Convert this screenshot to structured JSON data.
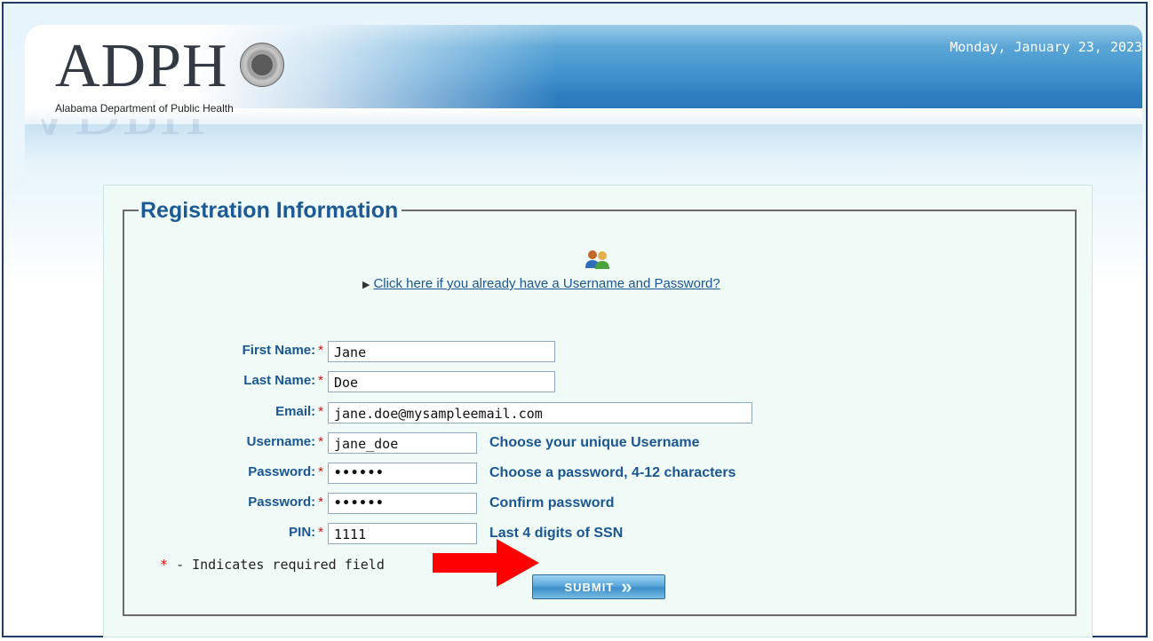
{
  "header": {
    "logo_text": "ADPH",
    "org_name": "Alabama Department of Public Health",
    "date": "Monday, January 23, 2023"
  },
  "form": {
    "legend": "Registration Information",
    "existing_account_link": "Click here if you already have a Username and Password?",
    "required_marker": "*",
    "fields": {
      "first_name": {
        "label": "First Name:",
        "value": "Jane"
      },
      "last_name": {
        "label": "Last Name:",
        "value": "Doe"
      },
      "email": {
        "label": "Email:",
        "value": "jane.doe@mysampleemail.com"
      },
      "username": {
        "label": "Username:",
        "value": "jane_doe",
        "hint": "Choose your unique Username"
      },
      "password": {
        "label": "Password:",
        "value": "••••••",
        "hint": "Choose a password, 4-12 characters"
      },
      "password_confirm": {
        "label": "Password:",
        "value": "••••••",
        "hint": "Confirm password"
      },
      "pin": {
        "label": "PIN:",
        "value": "1111",
        "hint": "Last 4 digits of SSN"
      }
    },
    "required_note": "- Indicates required field",
    "submit_label": "SUBMIT"
  },
  "icons": {
    "users": "users-icon",
    "link_arrow": "triangle-right-icon",
    "annotation": "red-arrow-icon"
  },
  "colors": {
    "label_blue": "#1a5694",
    "required_red": "#d01010",
    "annotation_red": "#ff0000"
  }
}
